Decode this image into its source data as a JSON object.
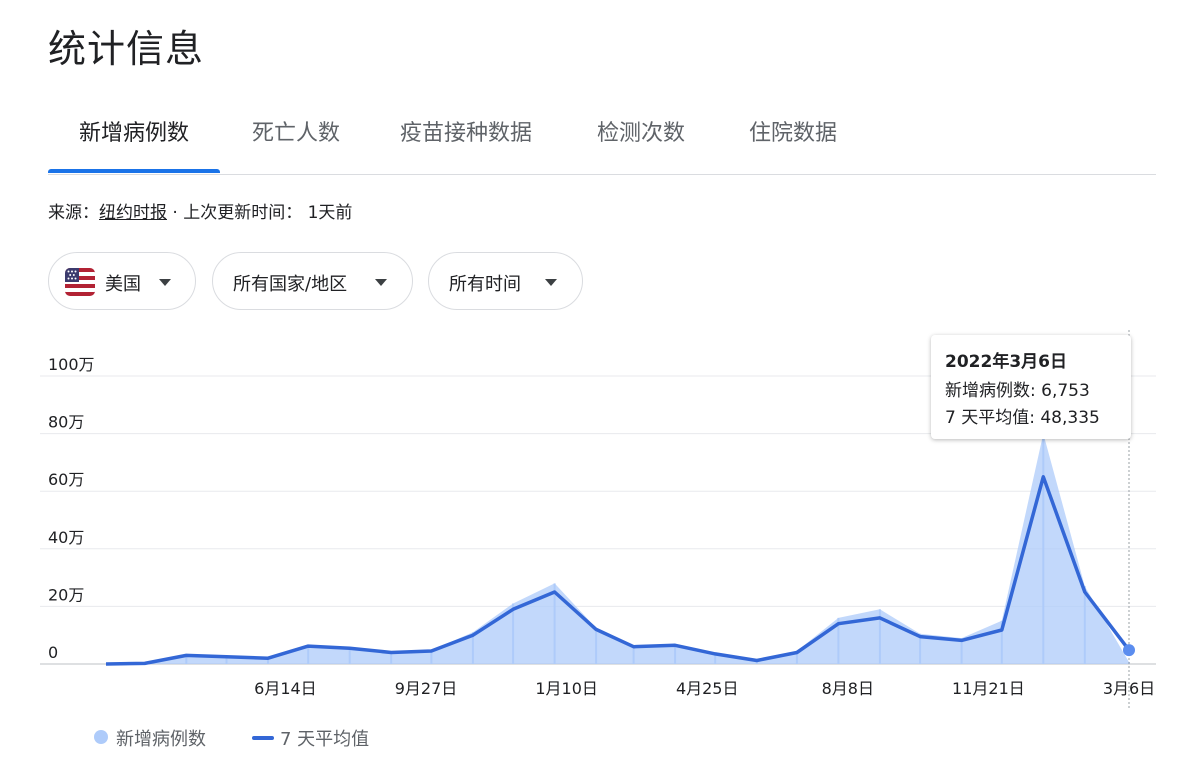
{
  "page_title": "统计信息",
  "tabs": [
    {
      "label": "新增病例数",
      "active": true
    },
    {
      "label": "死亡人数",
      "active": false
    },
    {
      "label": "疫苗接种数据",
      "active": false
    },
    {
      "label": "检测次数",
      "active": false
    },
    {
      "label": "住院数据",
      "active": false
    }
  ],
  "source": {
    "prefix": "来源：",
    "name": "纽约时报",
    "suffix": " · 上次更新时间： 1天前"
  },
  "filters": {
    "country": "美国",
    "region": "所有国家/地区",
    "period": "所有时间"
  },
  "tooltip": {
    "date": "2022年3月6日",
    "cases_label": "新增病例数: 6,753",
    "avg_label": "7 天平均值: 48,335"
  },
  "legend": {
    "cases": "新增病例数",
    "avg": "7 天平均值"
  },
  "colors": {
    "accent": "#1a73e8",
    "bars": "#aecbfa",
    "line": "#3367d6"
  },
  "chart_data": {
    "type": "area",
    "x_tick_labels": [
      "6月14日",
      "9月27日",
      "1月10日",
      "4月25日",
      "8月8日",
      "11月21日",
      "3月6日"
    ],
    "y_tick_labels": [
      "0",
      "20万",
      "40万",
      "60万",
      "80万",
      "100万"
    ],
    "y_ticks": [
      0,
      200000,
      400000,
      600000,
      800000,
      1000000
    ],
    "ylim": [
      0,
      1000000
    ],
    "x": [
      "2020-02-01",
      "2020-03-01",
      "2020-04-01",
      "2020-05-01",
      "2020-06-01",
      "2020-07-01",
      "2020-08-01",
      "2020-09-01",
      "2020-10-01",
      "2020-11-01",
      "2020-12-01",
      "2021-01-01",
      "2021-02-01",
      "2021-03-01",
      "2021-04-01",
      "2021-05-01",
      "2021-06-01",
      "2021-07-01",
      "2021-08-01",
      "2021-09-01",
      "2021-10-01",
      "2021-11-01",
      "2021-12-01",
      "2022-01-01",
      "2022-02-01",
      "2022-03-06"
    ],
    "series": [
      {
        "name": "7 天平均值",
        "values": [
          0,
          2000,
          30000,
          25000,
          20000,
          62000,
          55000,
          40000,
          45000,
          100000,
          190000,
          250000,
          120000,
          60000,
          65000,
          35000,
          12000,
          40000,
          140000,
          160000,
          95000,
          82000,
          118000,
          650000,
          250000,
          48335
        ]
      },
      {
        "name": "新增病例数",
        "values": [
          0,
          3000,
          32000,
          27000,
          21000,
          64000,
          56000,
          42000,
          48000,
          110000,
          210000,
          280000,
          125000,
          62000,
          68000,
          36000,
          13000,
          45000,
          160000,
          190000,
          105000,
          90000,
          150000,
          800000,
          270000,
          6753
        ]
      }
    ]
  }
}
